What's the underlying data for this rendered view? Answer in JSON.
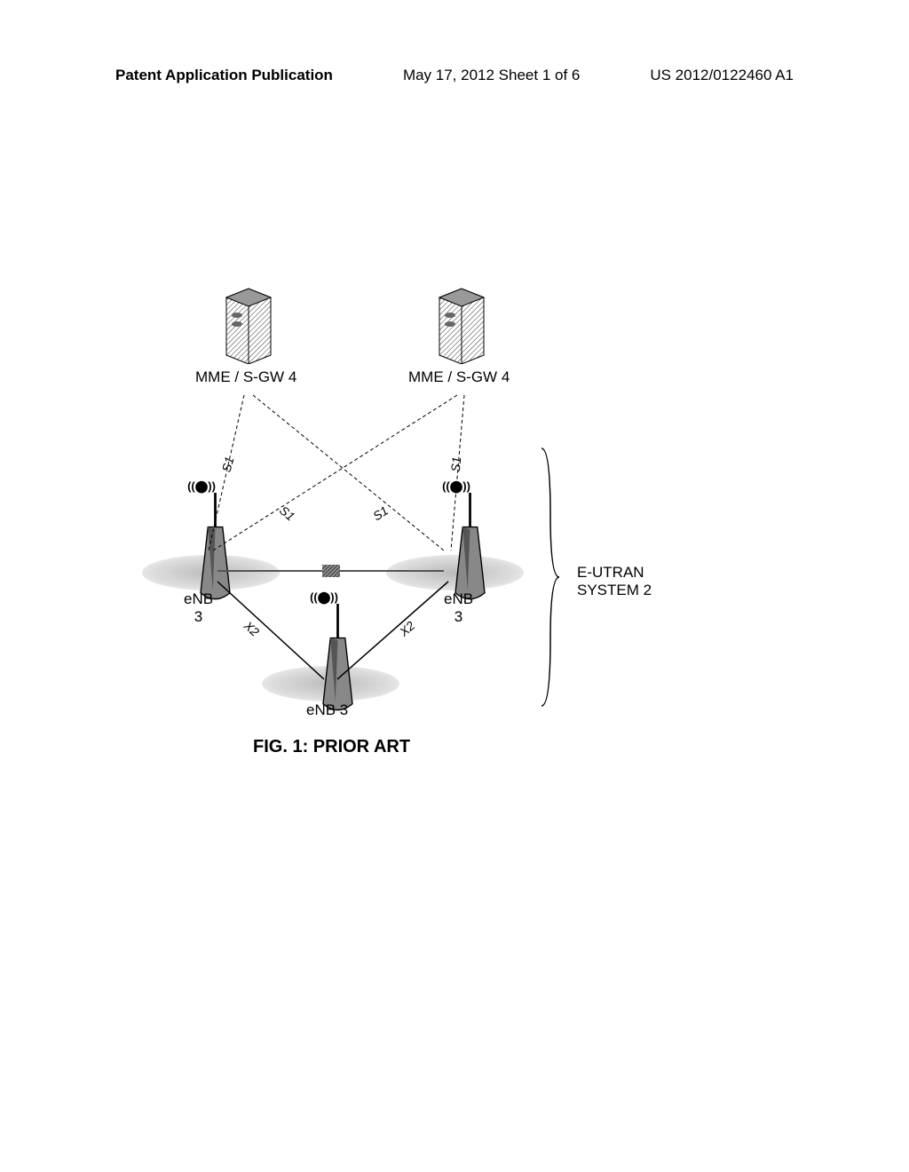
{
  "header": {
    "left": "Patent Application Publication",
    "center": "May 17, 2012  Sheet 1 of 6",
    "right": "US 2012/0122460 A1"
  },
  "diagram": {
    "servers": {
      "left": "MME / S-GW 4",
      "right": "MME / S-GW 4"
    },
    "antennas": {
      "left": "eNB\n3",
      "center": "eNB 3",
      "right": "eNB\n3"
    },
    "interfaces": {
      "s1": "S1",
      "x2": "X2"
    },
    "signal": "(((•)))",
    "system_label_line1": "E-UTRAN",
    "system_label_line2": "SYSTEM 2",
    "caption": "FIG. 1: PRIOR ART"
  }
}
